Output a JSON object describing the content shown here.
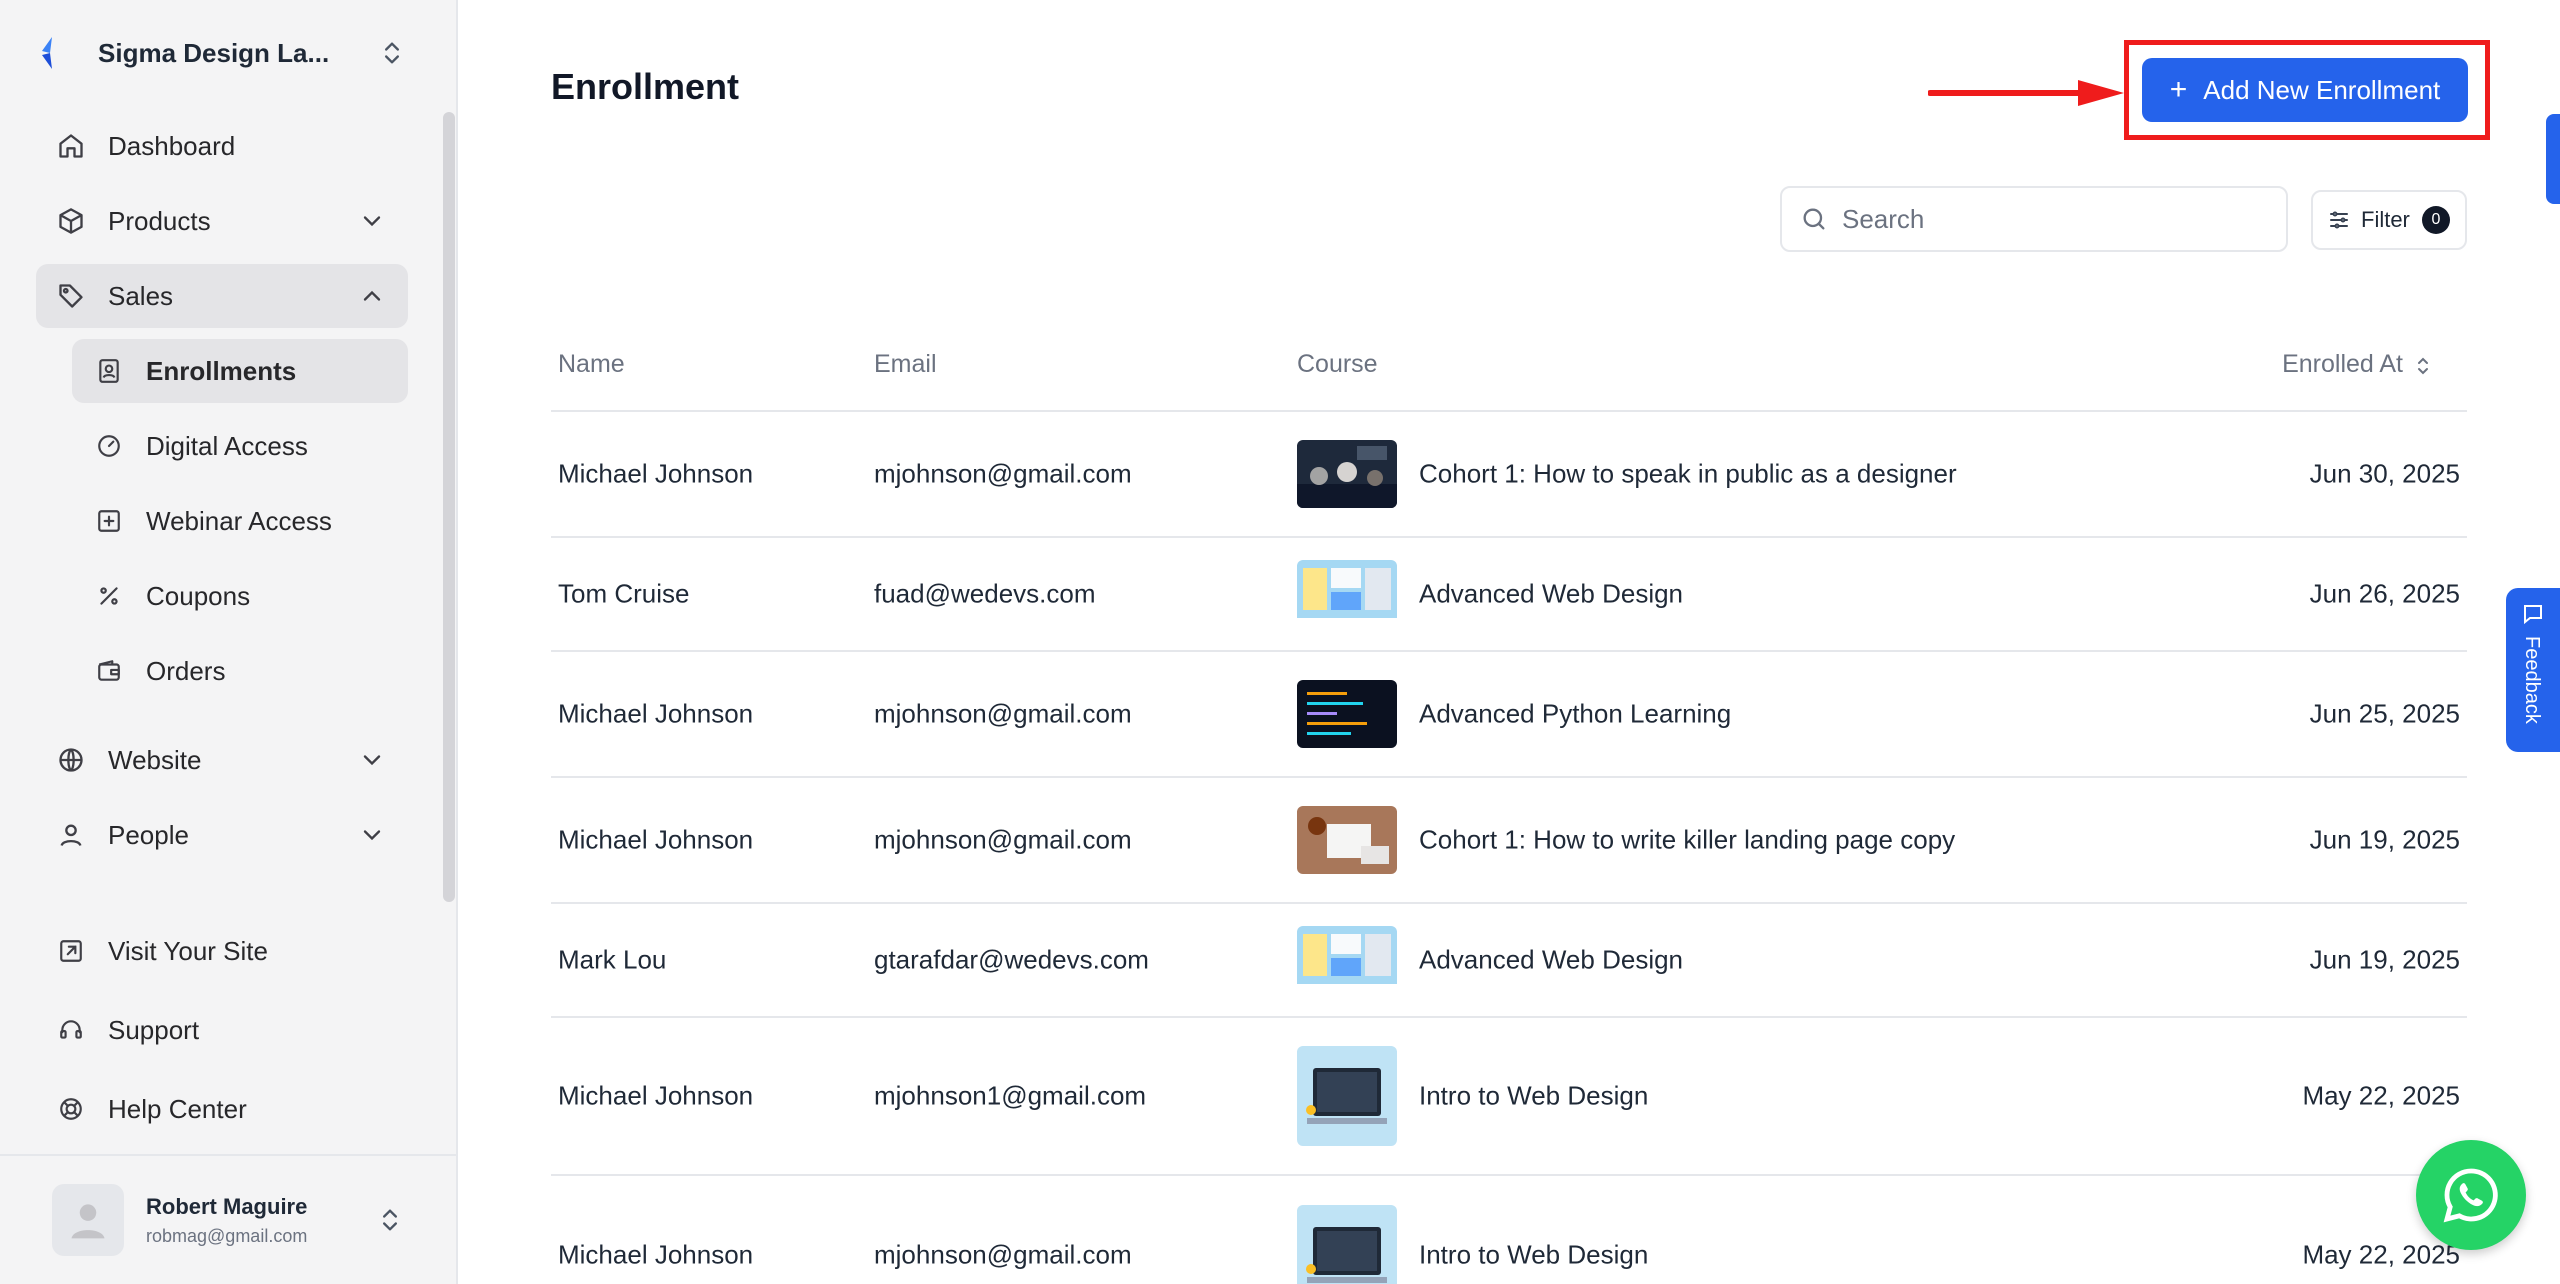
{
  "workspace": {
    "name": "Sigma Design La..."
  },
  "nav": {
    "dashboard": "Dashboard",
    "products": "Products",
    "sales": "Sales",
    "sales_children": {
      "enrollments": "Enrollments",
      "digital_access": "Digital Access",
      "webinar_access": "Webinar Access",
      "coupons": "Coupons",
      "orders": "Orders"
    },
    "website": "Website",
    "people": "People"
  },
  "bottom_nav": {
    "visit_site": "Visit Your Site",
    "support": "Support",
    "help_center": "Help Center"
  },
  "user": {
    "name": "Robert Maguire",
    "email": "robmag@gmail.com"
  },
  "page": {
    "title": "Enrollment",
    "add_button": "Add New Enrollment"
  },
  "search": {
    "placeholder": "Search"
  },
  "filter": {
    "label": "Filter",
    "count": "0"
  },
  "table": {
    "columns": {
      "name": "Name",
      "email": "Email",
      "course": "Course",
      "enrolled_at": "Enrolled At"
    },
    "rows": [
      {
        "name": "Michael Johnson",
        "email": "mjohnson@gmail.com",
        "course": "Cohort 1: How to speak in public as a designer",
        "date": "Jun 30, 2025"
      },
      {
        "name": "Tom Cruise",
        "email": "fuad@wedevs.com",
        "course": "Advanced Web Design",
        "date": "Jun 26, 2025"
      },
      {
        "name": "Michael Johnson",
        "email": "mjohnson@gmail.com",
        "course": "Advanced Python Learning",
        "date": "Jun 25, 2025"
      },
      {
        "name": "Michael Johnson",
        "email": "mjohnson@gmail.com",
        "course": "Cohort 1: How to write killer landing page copy",
        "date": "Jun 19, 2025"
      },
      {
        "name": "Mark Lou",
        "email": "gtarafdar@wedevs.com",
        "course": "Advanced Web Design",
        "date": "Jun 19, 2025"
      },
      {
        "name": "Michael Johnson",
        "email": "mjohnson1@gmail.com",
        "course": "Intro to Web Design",
        "date": "May 22, 2025"
      },
      {
        "name": "Michael Johnson",
        "email": "mjohnson@gmail.com",
        "course": "Intro to Web Design",
        "date": "May 22, 2025"
      }
    ]
  },
  "feedback": "Feedback",
  "colors": {
    "accent": "#2563eb",
    "highlight": "#ef1c1c",
    "whatsapp": "#25d366"
  }
}
